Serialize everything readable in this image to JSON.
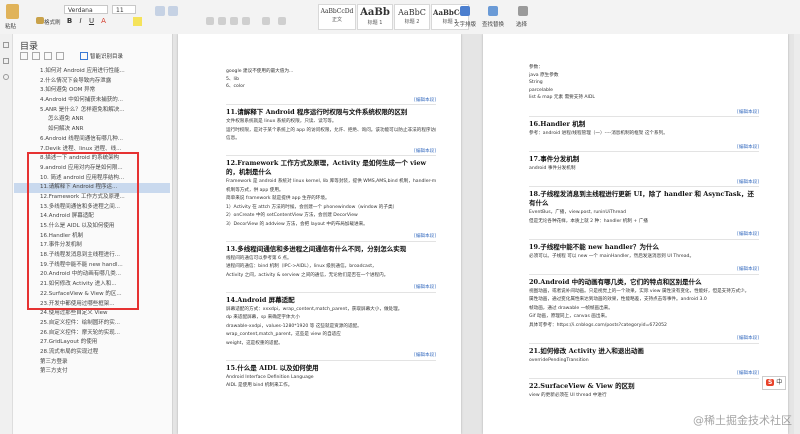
{
  "ribbon": {
    "font_name": "Verdana",
    "font_size": "11",
    "paste_label": "粘贴",
    "format_painter_label": "格式刷",
    "styles": [
      {
        "preview": "AaBbCcDd",
        "label": "正文"
      },
      {
        "preview": "AaBb",
        "label": "标题 1"
      },
      {
        "preview": "AaBbC",
        "label": "标题 2"
      },
      {
        "preview": "AaBbCcI",
        "label": "标题 3"
      }
    ],
    "text_tools_label": "文字排版",
    "find_replace_label": "查找替换",
    "select_label": "选择"
  },
  "sidebar": {
    "title": "目录",
    "smart_label": "智能识别目录",
    "items": [
      {
        "label": "1.如何对 Android 应用进行性能...",
        "level": 1
      },
      {
        "label": "2.什么情况下会导致内存泄露",
        "level": 1
      },
      {
        "label": "3.如何避免 OOM 异常",
        "level": 1
      },
      {
        "label": "4.Android 中如何捕获未捕获的...",
        "level": 1
      },
      {
        "label": "5.ANR 是什么？怎样避免和解决...",
        "level": 1
      },
      {
        "label": "怎么避免 ANR",
        "level": 2
      },
      {
        "label": "如何解决 ANR",
        "level": 2
      },
      {
        "label": "6.Android 线程间通信有哪几种...",
        "level": 1
      },
      {
        "label": "7.Devik 进程、linux 进程、线...",
        "level": 1
      },
      {
        "label": "8.描述一下 android 的系统架构",
        "level": 1
      },
      {
        "label": "9.android 应用对内存是如何限...",
        "level": 1
      },
      {
        "label": "10. 简述 android 应用程序结构...",
        "level": 1
      },
      {
        "label": "11.请解释下 Android 程序运...",
        "level": 1
      },
      {
        "label": "12.Framework 工作方式及原理...",
        "level": 1
      },
      {
        "label": "13.多线程间通信和多进程之间...",
        "level": 1
      },
      {
        "label": "14.Android 屏幕适配",
        "level": 1
      },
      {
        "label": "15.什么是 AIDL 以及如何使用",
        "level": 1
      },
      {
        "label": "16.Handler 机制",
        "level": 1
      },
      {
        "label": "17.事件分发机制",
        "level": 1
      },
      {
        "label": "18.子线程发消息到主线程进行...",
        "level": 1
      },
      {
        "label": "19.子线程中能不能 new handl...",
        "level": 1
      },
      {
        "label": "20.Android 中的动画有哪几类...",
        "level": 1
      },
      {
        "label": "21.如何修改 Activity 进入和...",
        "level": 1
      },
      {
        "label": "22.SurfaceView & View 的区...",
        "level": 1
      },
      {
        "label": "23.开发中都使用过哪些框架...",
        "level": 1
      },
      {
        "label": "24.使用过那些自定义 View",
        "level": 1
      },
      {
        "label": "25.自定义控件：绘制圆环的实...",
        "level": 1
      },
      {
        "label": "26.自定义控件：摩天轮的实现...",
        "level": 1
      },
      {
        "label": "27.GridLayout 的使用",
        "level": 1
      },
      {
        "label": "28.流式布局的实现过程",
        "level": 1
      },
      {
        "label": "第三方登录",
        "level": 1
      },
      {
        "label": "第三方支付",
        "level": 1
      }
    ]
  },
  "page1": {
    "top_lines": [
      "google 建议不使用的最大值为...",
      "5、lib",
      "6、color"
    ],
    "sections": [
      {
        "heading": "11.请解释下 Android 程序运行时权限与文件系统权限的区别",
        "lines": [
          "文件权限系统就是 linux 系统的权限，只读、读写等。",
          "运行时权限，是对于某个系统上的 app 的访问权限，允许、拒绝、询问。该功能可以防止非法的程序访问敏感的",
          "信息。"
        ]
      },
      {
        "heading": "12.Framework 工作方式及原理，Activity 是如何生成一个 view 的，机制是什么",
        "lines": [
          "Framework 是 android 系统对 linux kernel, lib 库等封装，提供 WMS,AMS,bind 机制，handler-message",
          "机制等方式，供 app 使用。",
          "简单来说 framework 就是提供 app 生存的环境。",
          "1）Activity 在 attch 方法的时候，会创建一个 phonewindow（window 的子类）",
          "2）onCreate 中的 setContentView 方法，会创建 DecorView",
          "3）DecorView 的 addview 方法，会把 layout 中的布局加载进来。"
        ]
      },
      {
        "heading": "13.多线程间通信和多进程之间通信有什么不同，分别怎么实现",
        "lines": [
          "线程间的通信可以参考第 6 点。",
          "进程间的通信：bind 机制（IPC->AIDL），linux 级别通信，broadcast，",
          "Activity 之间，activity & serview 之间的通信，无论他们是否在一个进程内。"
        ]
      },
      {
        "heading": "14.Android 屏幕适配",
        "lines": [
          "屏幕适配的方式：xxxdpi，wrap_content,match_parent，获取屏幕大小，做处理。",
          "dp 来适配屏幕，sp 来确定字体大小",
          "drawable-xxdpi，values-1280*1920 等 这些就是资源的适配。",
          "wrap_content,match_parent，这些是 view 的自适应",
          "weight，这是权重的适配。"
        ]
      },
      {
        "heading": "15.什么是 AIDL 以及如何使用",
        "lines": [
          "Android Interface Definition Language",
          "AIDL 是使用 bind 机制来工作。"
        ]
      }
    ],
    "edit_label": "[编辑本段]"
  },
  "page2": {
    "top_lines": [
      "参数：",
      "java 原生参数",
      "String",
      "parcelable",
      "list & map 元素 需要支持 AIDL"
    ],
    "sections": [
      {
        "heading": "16.Handler 机制",
        "lines": [
          "参考：android 进程/线程管理（一）----消息机制的框架 这个系列。"
        ]
      },
      {
        "heading": "17.事件分发机制",
        "lines": [
          "android 事件分发机制"
        ]
      },
      {
        "heading": "18.子线程发消息到主线程进行更新 UI，除了 handler 和 AsyncTask，还有什么",
        "lines": [
          "EventBus，广播，view.post, runinUiThread",
          "但是无论各种花样，本质上就 2 种：handler 机制 + 广播"
        ]
      },
      {
        "heading": "19.子线程中能不能 new handler？为什么",
        "lines": [
          "必须可以。子线程 可以 new 一个 mainHandler，然后发送消息到 UI Thread。"
        ]
      },
      {
        "heading": "20.Android 中的动画有哪几类，它们的特点和区别是什么",
        "lines": [
          "视图动画，或者说补间动画。只是视觉上的一个效果，实际 view 属性没有变化，性能好，但是支持方式少。",
          "属性动画，通过变化属性来达到动画的效果，性能略差，支持点击等事件。android 3.0",
          "帧动画，通过 drawable 一帧帧画出来。",
          "Gif 动画，原理同上，canvas 画出来。",
          "具体可参考：https://i.cnblogs.com/posts?categoryid=672052"
        ]
      },
      {
        "heading": "21.如何修改 Activity 进入和退出动画",
        "lines": [
          "overridePendingTransition"
        ]
      },
      {
        "heading": "22.SurfaceView & View 的区别",
        "lines": [
          "view 的更新必须在 UI thread 中进行"
        ]
      }
    ],
    "edit_label": "[编辑本段]"
  },
  "ime_label": "中",
  "watermark": "@稀土掘金技术社区"
}
